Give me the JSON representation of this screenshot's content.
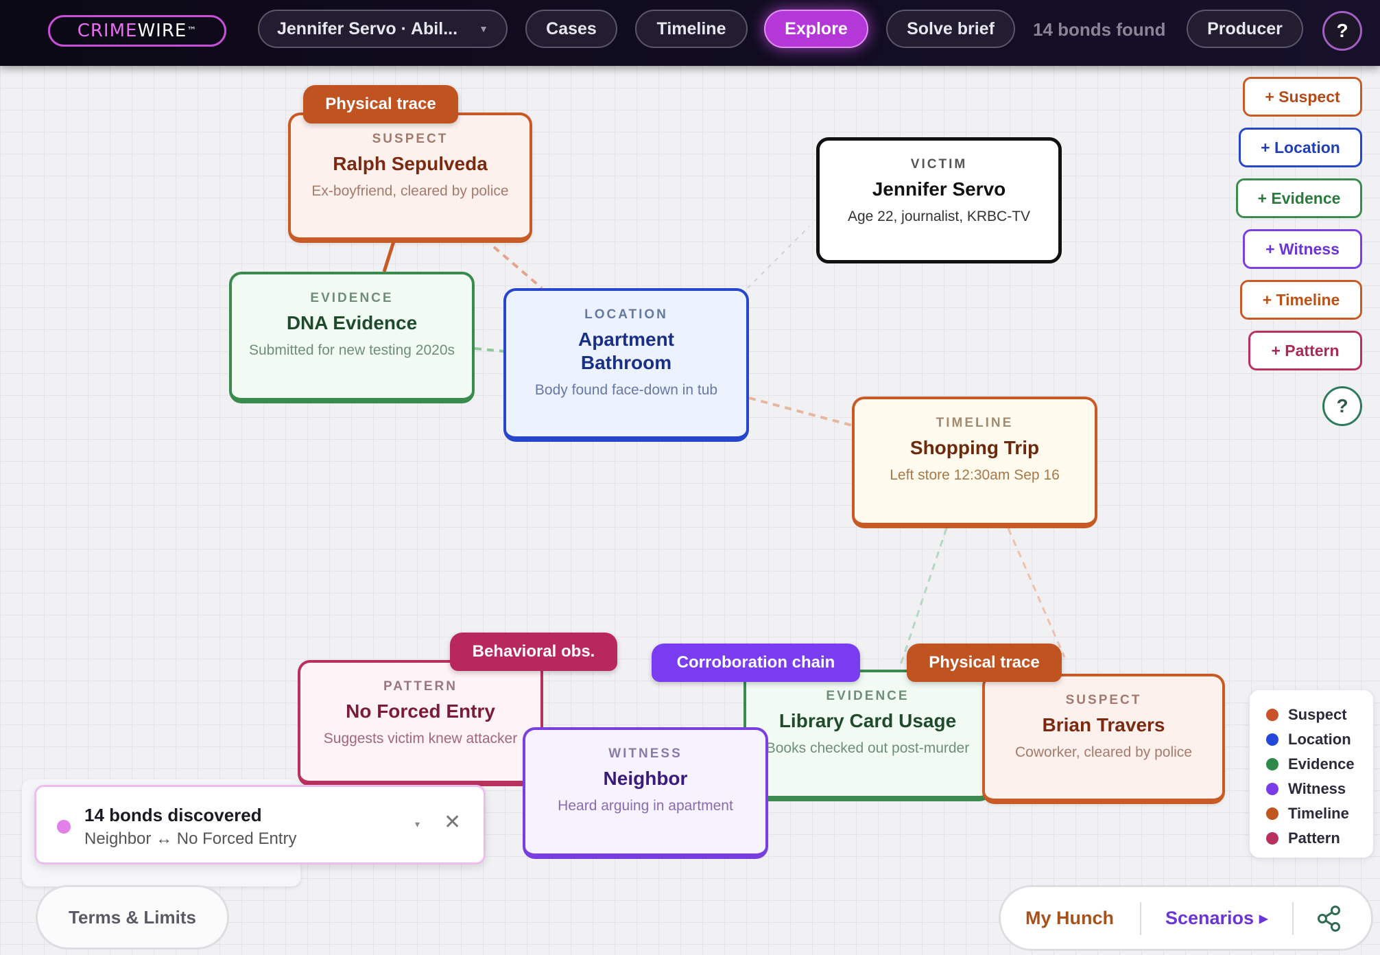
{
  "header": {
    "logo": {
      "part1": "CRIME",
      "part2": "WIRE",
      "tm": "™"
    },
    "case_select": "Jennifer Servo · Abil...",
    "nav": [
      "Cases",
      "Timeline",
      "Explore",
      "Solve brief"
    ],
    "active_tab": "Explore",
    "bonds_found": "14 bonds found",
    "producer": "Producer",
    "help": "?"
  },
  "nodes": {
    "ralph": {
      "kind": "SUSPECT",
      "title": "Ralph Sepulveda",
      "sub": "Ex-boyfriend, cleared by police",
      "tag": "Physical trace"
    },
    "dna": {
      "kind": "EVIDENCE",
      "title": "DNA Evidence",
      "sub": "Submitted for new testing 2020s"
    },
    "bathroom": {
      "kind": "LOCATION",
      "title": "Apartment Bathroom",
      "sub": "Body found face-down in tub"
    },
    "victim": {
      "kind": "VICTIM",
      "title": "Jennifer Servo",
      "sub": "Age 22, journalist, KRBC-TV"
    },
    "shopping": {
      "kind": "TIMELINE",
      "title": "Shopping Trip",
      "sub": "Left store 12:30am Sep 16"
    },
    "forced": {
      "kind": "PATTERN",
      "title": "No Forced Entry",
      "sub": "Suggests victim knew attacker",
      "tag": "Behavioral obs."
    },
    "neighbor": {
      "kind": "WITNESS",
      "title": "Neighbor",
      "sub": "Heard arguing in apartment"
    },
    "library": {
      "kind": "EVIDENCE",
      "title": "Library Card Usage",
      "sub": "Books checked out post-murder",
      "tag": "Corroboration chain"
    },
    "brian": {
      "kind": "SUSPECT",
      "title": "Brian Travers",
      "sub": "Coworker, cleared by police",
      "tag": "Physical trace"
    }
  },
  "add_buttons": [
    "+ Suspect",
    "+ Location",
    "+ Evidence",
    "+ Witness",
    "+ Timeline",
    "+ Pattern"
  ],
  "help_right": "?",
  "legend": [
    {
      "label": "Suspect",
      "color": "#c8522a"
    },
    {
      "label": "Location",
      "color": "#2347d8"
    },
    {
      "label": "Evidence",
      "color": "#2e8a48"
    },
    {
      "label": "Witness",
      "color": "#7a3ce8"
    },
    {
      "label": "Timeline",
      "color": "#c0561e"
    },
    {
      "label": "Pattern",
      "color": "#b8305e"
    }
  ],
  "toast": {
    "title": "14 bonds discovered",
    "detail": "Neighbor ↔ No Forced Entry",
    "caret": "▾",
    "close": "✕"
  },
  "footer": {
    "terms": "Terms & Limits",
    "hunch": "My Hunch",
    "scenarios": "Scenarios ▸"
  },
  "colors": {
    "accent": "#b437d8",
    "suspect": "#c85a26",
    "location": "#2647cc",
    "evidence": "#3b8a4e",
    "witness": "#7a3fe0",
    "pattern": "#b8305e"
  }
}
